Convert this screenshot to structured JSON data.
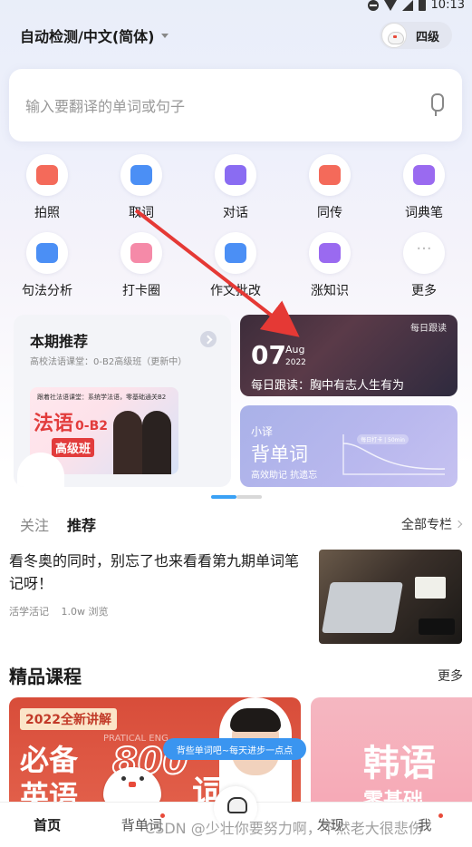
{
  "status": {
    "time": "10:13"
  },
  "header": {
    "language": "自动检测/中文(简体)",
    "level": "四级"
  },
  "search": {
    "placeholder": "输入要翻译的单词或句子"
  },
  "tools": {
    "row1": [
      {
        "label": "拍照",
        "icon": "camera-icon",
        "color": "#f46a5a"
      },
      {
        "label": "取词",
        "icon": "word-pick-icon",
        "color": "#4b8ff5"
      },
      {
        "label": "对话",
        "icon": "chat-icon",
        "color": "#8a6cf2"
      },
      {
        "label": "同传",
        "icon": "simul-interpret-icon",
        "color": "#f46a5a"
      },
      {
        "label": "词典笔",
        "icon": "dict-pen-icon",
        "color": "#9a6af0"
      }
    ],
    "row2": [
      {
        "label": "句法分析",
        "icon": "syntax-icon",
        "color": "#4b8ff5"
      },
      {
        "label": "打卡圈",
        "icon": "checkin-icon",
        "color": "#f58aa8"
      },
      {
        "label": "作文批改",
        "icon": "essay-correct-icon",
        "color": "#4b8ff5"
      },
      {
        "label": "涨知识",
        "icon": "knowledge-icon",
        "color": "#9a6af0"
      },
      {
        "label": "更多",
        "icon": "more-dots-icon",
        "color": "#bbbbbb"
      }
    ]
  },
  "recommend": {
    "title": "本期推荐",
    "subtitle": "高校法语课堂：0-B2高级班（更新中）",
    "thumb_top": "跟着社法语课堂：系统学法语，零基础通关B2",
    "thumb_big": "法语",
    "thumb_level": "0-B2",
    "thumb_ban": "高级班"
  },
  "daily": {
    "tag": "每日跟读",
    "day": "07",
    "month": "Aug",
    "year": "2022",
    "text": "每日跟读：胸中有志人生有为"
  },
  "vocab": {
    "small": "小译",
    "big": "背单词",
    "sub": "高效助记 抗遗忘",
    "pill": "每日打卡 | 50min"
  },
  "feed": {
    "tabs": [
      {
        "label": "关注"
      },
      {
        "label": "推荐"
      }
    ],
    "all_columns": "全部专栏",
    "article": {
      "title": "看冬奥的同时，别忘了也来看看第九期单词笔记呀！",
      "author": "活学活记",
      "views": "1.0w 浏览"
    }
  },
  "courses": {
    "title": "精品课程",
    "more": "更多",
    "card1": {
      "tag": "2022全新讲解",
      "line1": "必备",
      "line2": "英语",
      "num": "800",
      "ci": "词",
      "en": "PRATICAL ENG"
    },
    "card2": {
      "big": "韩语",
      "big2": "零基础"
    }
  },
  "bubble": "背些单词吧~每天进步一点点",
  "nav": {
    "home": "首页",
    "words": "背单词",
    "discover": "发现",
    "me": "我"
  },
  "watermark": "CSDN @少壮你要努力啊，不然老大很悲伤"
}
